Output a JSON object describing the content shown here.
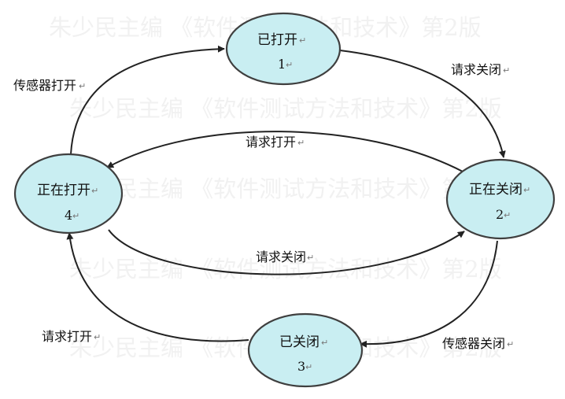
{
  "watermark": {
    "text": "朱少民主编 《软件测试方法和技术》第2版"
  },
  "paragraph_mark": "↵",
  "nodes": {
    "opened": {
      "label": "已打开",
      "number": "1"
    },
    "closing": {
      "label": "正在关闭",
      "number": "2"
    },
    "closed": {
      "label": "已关闭",
      "number": "3"
    },
    "opening": {
      "label": "正在打开",
      "number": "4"
    }
  },
  "edges": {
    "opened_to_closing": {
      "label": "请求关闭"
    },
    "closing_to_opening": {
      "label": "请求打开"
    },
    "opening_to_closing": {
      "label": "请求关闭"
    },
    "closing_to_closed": {
      "label": "传感器关闭"
    },
    "closed_to_opening": {
      "label": "请求打开"
    },
    "opening_to_opened": {
      "label": "传感器打开"
    }
  },
  "colors": {
    "node_fill": "#c9eef2",
    "node_stroke": "#3f3f3f",
    "edge": "#222222",
    "watermark": "#f1f1f1"
  }
}
